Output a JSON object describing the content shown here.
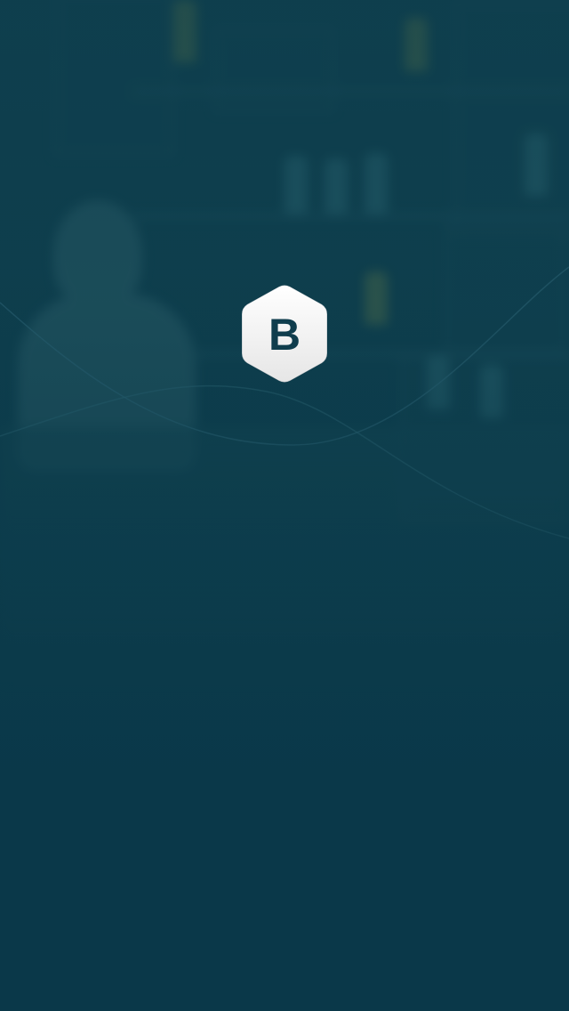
{
  "splash": {
    "logo_letter": "B",
    "logo_icon": "hexagon-b-logo-icon"
  },
  "colors": {
    "background": "#0b3a4a",
    "logo_fill": "#f4f4f4",
    "logo_letter": "#0f3d4d"
  }
}
